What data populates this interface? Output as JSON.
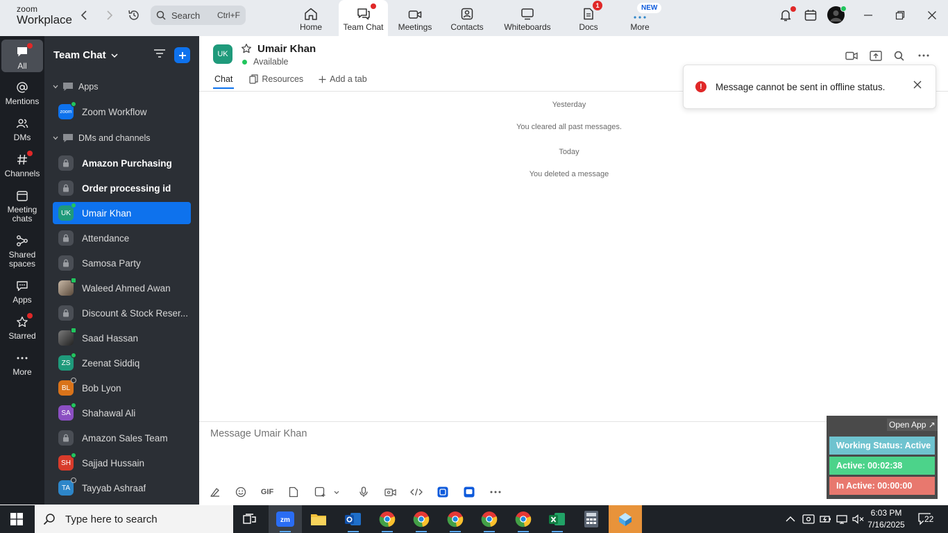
{
  "app": {
    "logo_line1": "zoom",
    "logo_line2": "Workplace"
  },
  "search": {
    "label": "Search",
    "shortcut": "Ctrl+F"
  },
  "nav_tabs": [
    {
      "label": "Home",
      "icon": "home-icon"
    },
    {
      "label": "Team Chat",
      "icon": "chat-icon",
      "active": true
    },
    {
      "label": "Meetings",
      "icon": "video-icon"
    },
    {
      "label": "Contacts",
      "icon": "contacts-icon"
    },
    {
      "label": "Whiteboards",
      "icon": "whiteboard-icon"
    },
    {
      "label": "Docs",
      "icon": "doc-icon",
      "badge": "1"
    },
    {
      "label": "More",
      "icon": "more-icon",
      "badge": "NEW"
    }
  ],
  "rail": [
    {
      "label": "All",
      "icon": "chat-icon",
      "active": true
    },
    {
      "label": "Mentions",
      "icon": "at-icon"
    },
    {
      "label": "DMs",
      "icon": "people-icon"
    },
    {
      "label": "Channels",
      "icon": "hash-icon"
    },
    {
      "label": "Meeting chats",
      "icon": "calendar-icon"
    },
    {
      "label": "Shared spaces",
      "icon": "share-icon"
    },
    {
      "label": "Apps",
      "icon": "apps-icon"
    },
    {
      "label": "Starred",
      "icon": "star-icon"
    },
    {
      "label": "More",
      "icon": "ellipsis-icon"
    }
  ],
  "sidebar": {
    "title": "Team Chat",
    "apps_section": "Apps",
    "apps": [
      {
        "label": "Zoom Workflow",
        "avatar": "zoom"
      }
    ],
    "dms_section": "DMs and channels",
    "items": [
      {
        "label": "Amazon Purchasing",
        "type": "channel",
        "bold": true
      },
      {
        "label": "Order processing id",
        "type": "channel",
        "bold": true
      },
      {
        "label": "Umair Khan",
        "type": "user",
        "initials": "UK",
        "color": "#1f9a7b",
        "selected": true
      },
      {
        "label": "Attendance",
        "type": "channel"
      },
      {
        "label": "Samosa Party",
        "type": "channel"
      },
      {
        "label": "Waleed Ahmed Awan",
        "type": "user",
        "initials": "",
        "color": "#6b5a4a"
      },
      {
        "label": "Discount & Stock Reser...",
        "type": "channel"
      },
      {
        "label": "Saad Hassan",
        "type": "user",
        "initials": "",
        "color": "#3a3a3a"
      },
      {
        "label": "Zeenat Siddiq",
        "type": "user",
        "initials": "ZS",
        "color": "#1f9a7b"
      },
      {
        "label": "Bob Lyon",
        "type": "user",
        "initials": "BL",
        "color": "#d9731a"
      },
      {
        "label": "Shahawal Ali",
        "type": "user",
        "initials": "SA",
        "color": "#8b4fc2"
      },
      {
        "label": "Amazon Sales Team",
        "type": "channel"
      },
      {
        "label": "Sajjad Hussain",
        "type": "user",
        "initials": "SH",
        "color": "#d83b2b"
      },
      {
        "label": "Tayyab Ashraaf",
        "type": "user",
        "initials": "TA",
        "color": "#2d86c9"
      }
    ]
  },
  "chat": {
    "contact_initials": "UK",
    "contact_name": "Umair Khan",
    "status": "Available",
    "tabs": [
      "Chat",
      "Resources",
      "Add a tab"
    ],
    "messages": [
      {
        "text": "Yesterday",
        "kind": "date"
      },
      {
        "text": "You cleared all past messages.",
        "kind": "system"
      },
      {
        "text": "Today",
        "kind": "date"
      },
      {
        "text": "You deleted a message",
        "kind": "system"
      }
    ],
    "composer_placeholder": "Message Umair Khan",
    "composer_tools": {
      "gif": "GIF"
    }
  },
  "toast": {
    "message": "Message cannot be sent in offline status."
  },
  "widget": {
    "open_app": "Open App ↗",
    "working_status": "Working Status: Active",
    "active_time": "Active: 00:02:38",
    "inactive_time": "In Active: 00:00:00"
  },
  "taskbar": {
    "search_placeholder": "Type here to search",
    "time": "6:03 PM",
    "date": "7/16/2025",
    "notification_count": "22"
  },
  "colors": {
    "accent": "#0e72ed",
    "rail_bg": "#1b1e23",
    "sidebar_bg": "#2b2f35",
    "alert": "#e02828"
  }
}
